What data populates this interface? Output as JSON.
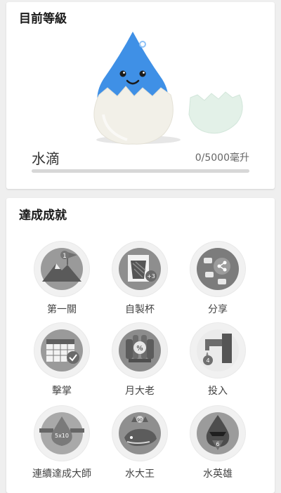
{
  "current_level": {
    "title": "目前等級",
    "level_name": "水滴",
    "progress_text": "0/5000毫升",
    "progress_fraction": 0,
    "accent_color": "#3b8fe0"
  },
  "achievements": {
    "title": "達成成就",
    "items": [
      {
        "label": "第一關",
        "icon": "mountain-flag-icon",
        "number": "1"
      },
      {
        "label": "自製杯",
        "icon": "custom-cup-icon",
        "number": "+3"
      },
      {
        "label": "分享",
        "icon": "share-icon",
        "number": ""
      },
      {
        "label": "擊掌",
        "icon": "calendar-check-icon",
        "number": ""
      },
      {
        "label": "月大老",
        "icon": "bottles-percent-icon",
        "number": "%"
      },
      {
        "label": "投入",
        "icon": "faucet-icon",
        "number": "4"
      },
      {
        "label": "連續達成大師",
        "icon": "drop-chain-icon",
        "number": "5x10"
      },
      {
        "label": "水大王",
        "icon": "whale-crown-icon",
        "number": "90"
      },
      {
        "label": "水英雄",
        "icon": "hero-drop-icon",
        "number": "6"
      }
    ]
  }
}
